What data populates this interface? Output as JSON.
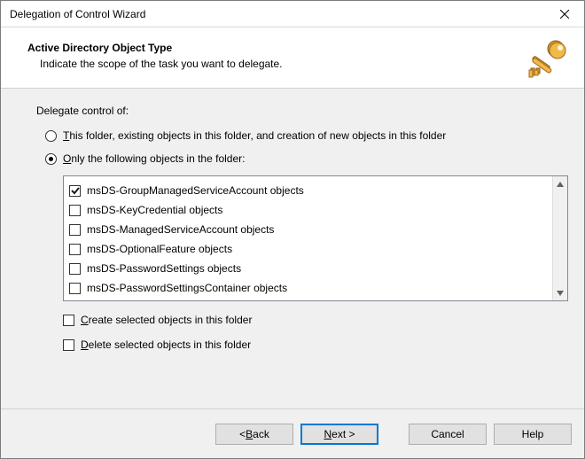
{
  "title": "Delegation of Control Wizard",
  "header": {
    "heading": "Active Directory Object Type",
    "subheading": "Indicate the scope of the task you want to delegate."
  },
  "body": {
    "intro": "Delegate control of:",
    "radioA_pre": "",
    "radioA_u": "T",
    "radioA_post": "his folder, existing objects in this folder, and creation of new objects in this folder",
    "radioB_pre": "",
    "radioB_u": "O",
    "radioB_post": "nly the following objects in the folder:",
    "radioSelected": "B",
    "items": [
      {
        "label": "msDS-GroupManagedServiceAccount objects",
        "checked": true
      },
      {
        "label": "msDS-KeyCredential objects",
        "checked": false
      },
      {
        "label": "msDS-ManagedServiceAccount objects",
        "checked": false
      },
      {
        "label": "msDS-OptionalFeature objects",
        "checked": false
      },
      {
        "label": "msDS-PasswordSettings objects",
        "checked": false
      },
      {
        "label": "msDS-PasswordSettingsContainer objects",
        "checked": false
      }
    ],
    "checkCreate_u": "C",
    "checkCreate_post": "reate selected objects in this folder",
    "checkDelete_u": "D",
    "checkDelete_post": "elete selected objects in this folder"
  },
  "footer": {
    "back_pre": "< ",
    "back_u": "B",
    "back_post": "ack",
    "next_u": "N",
    "next_post": "ext >",
    "cancel": "Cancel",
    "help": "Help"
  }
}
